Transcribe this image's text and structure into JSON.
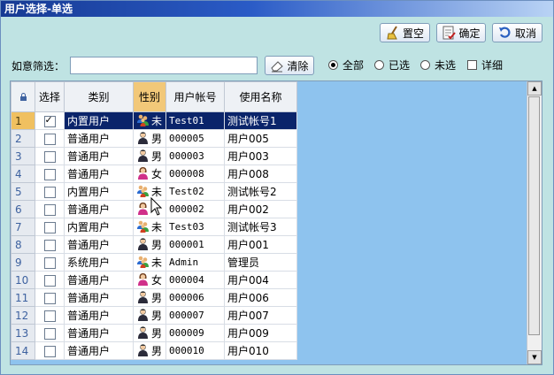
{
  "window": {
    "title": "用户选择-单选"
  },
  "toolbar": {
    "clear_label": "置空",
    "ok_label": "确定",
    "cancel_label": "取消"
  },
  "filter": {
    "label": "如意筛选：",
    "value": "",
    "clear_btn": "清除",
    "options": [
      {
        "label": "全部",
        "selected": true
      },
      {
        "label": "已选",
        "selected": false
      },
      {
        "label": "未选",
        "selected": false
      }
    ],
    "detail_label": "详细",
    "detail_checked": false
  },
  "grid": {
    "columns": [
      "选择",
      "类别",
      "性别",
      "用户帐号",
      "使用名称"
    ],
    "sorted_column": "性别",
    "rows": [
      {
        "no": "1",
        "checked": true,
        "category": "内置用户",
        "gender": "未",
        "gender_icon": "group-user-icon",
        "account": "Test01",
        "name": "测试帐号1",
        "selected": true
      },
      {
        "no": "2",
        "checked": false,
        "category": "普通用户",
        "gender": "男",
        "gender_icon": "male-user-icon",
        "account": "000005",
        "name": "用户005"
      },
      {
        "no": "3",
        "checked": false,
        "category": "普通用户",
        "gender": "男",
        "gender_icon": "male-user-icon",
        "account": "000003",
        "name": "用户003"
      },
      {
        "no": "4",
        "checked": false,
        "category": "普通用户",
        "gender": "女",
        "gender_icon": "female-user-icon",
        "account": "000008",
        "name": "用户008"
      },
      {
        "no": "5",
        "checked": false,
        "category": "内置用户",
        "gender": "未",
        "gender_icon": "group-user-icon",
        "account": "Test02",
        "name": "测试帐号2"
      },
      {
        "no": "6",
        "checked": false,
        "category": "普通用户",
        "gender": "",
        "gender_icon": "female-user-icon",
        "account": "000002",
        "name": "用户002"
      },
      {
        "no": "7",
        "checked": false,
        "category": "内置用户",
        "gender": "未",
        "gender_icon": "group-user-icon",
        "account": "Test03",
        "name": "测试帐号3"
      },
      {
        "no": "8",
        "checked": false,
        "category": "普通用户",
        "gender": "男",
        "gender_icon": "male-user-icon",
        "account": "000001",
        "name": "用户001"
      },
      {
        "no": "9",
        "checked": false,
        "category": "系统用户",
        "gender": "未",
        "gender_icon": "group-user-icon",
        "account": "Admin",
        "name": "管理员"
      },
      {
        "no": "10",
        "checked": false,
        "category": "普通用户",
        "gender": "女",
        "gender_icon": "female-user-icon",
        "account": "000004",
        "name": "用户004"
      },
      {
        "no": "11",
        "checked": false,
        "category": "普通用户",
        "gender": "男",
        "gender_icon": "male-user-icon",
        "account": "000006",
        "name": "用户006"
      },
      {
        "no": "12",
        "checked": false,
        "category": "普通用户",
        "gender": "男",
        "gender_icon": "male-user-icon",
        "account": "000007",
        "name": "用户007"
      },
      {
        "no": "13",
        "checked": false,
        "category": "普通用户",
        "gender": "男",
        "gender_icon": "male-user-icon",
        "account": "000009",
        "name": "用户009"
      },
      {
        "no": "14",
        "checked": false,
        "category": "普通用户",
        "gender": "男",
        "gender_icon": "male-user-icon",
        "account": "000010",
        "name": "用户010"
      }
    ]
  },
  "colors": {
    "title_start": "#173a93",
    "selected_row": "#0a246a",
    "sorted_header": "#f2c879",
    "right_panel": "#8ec3ee",
    "background": "#bfe3e3"
  }
}
